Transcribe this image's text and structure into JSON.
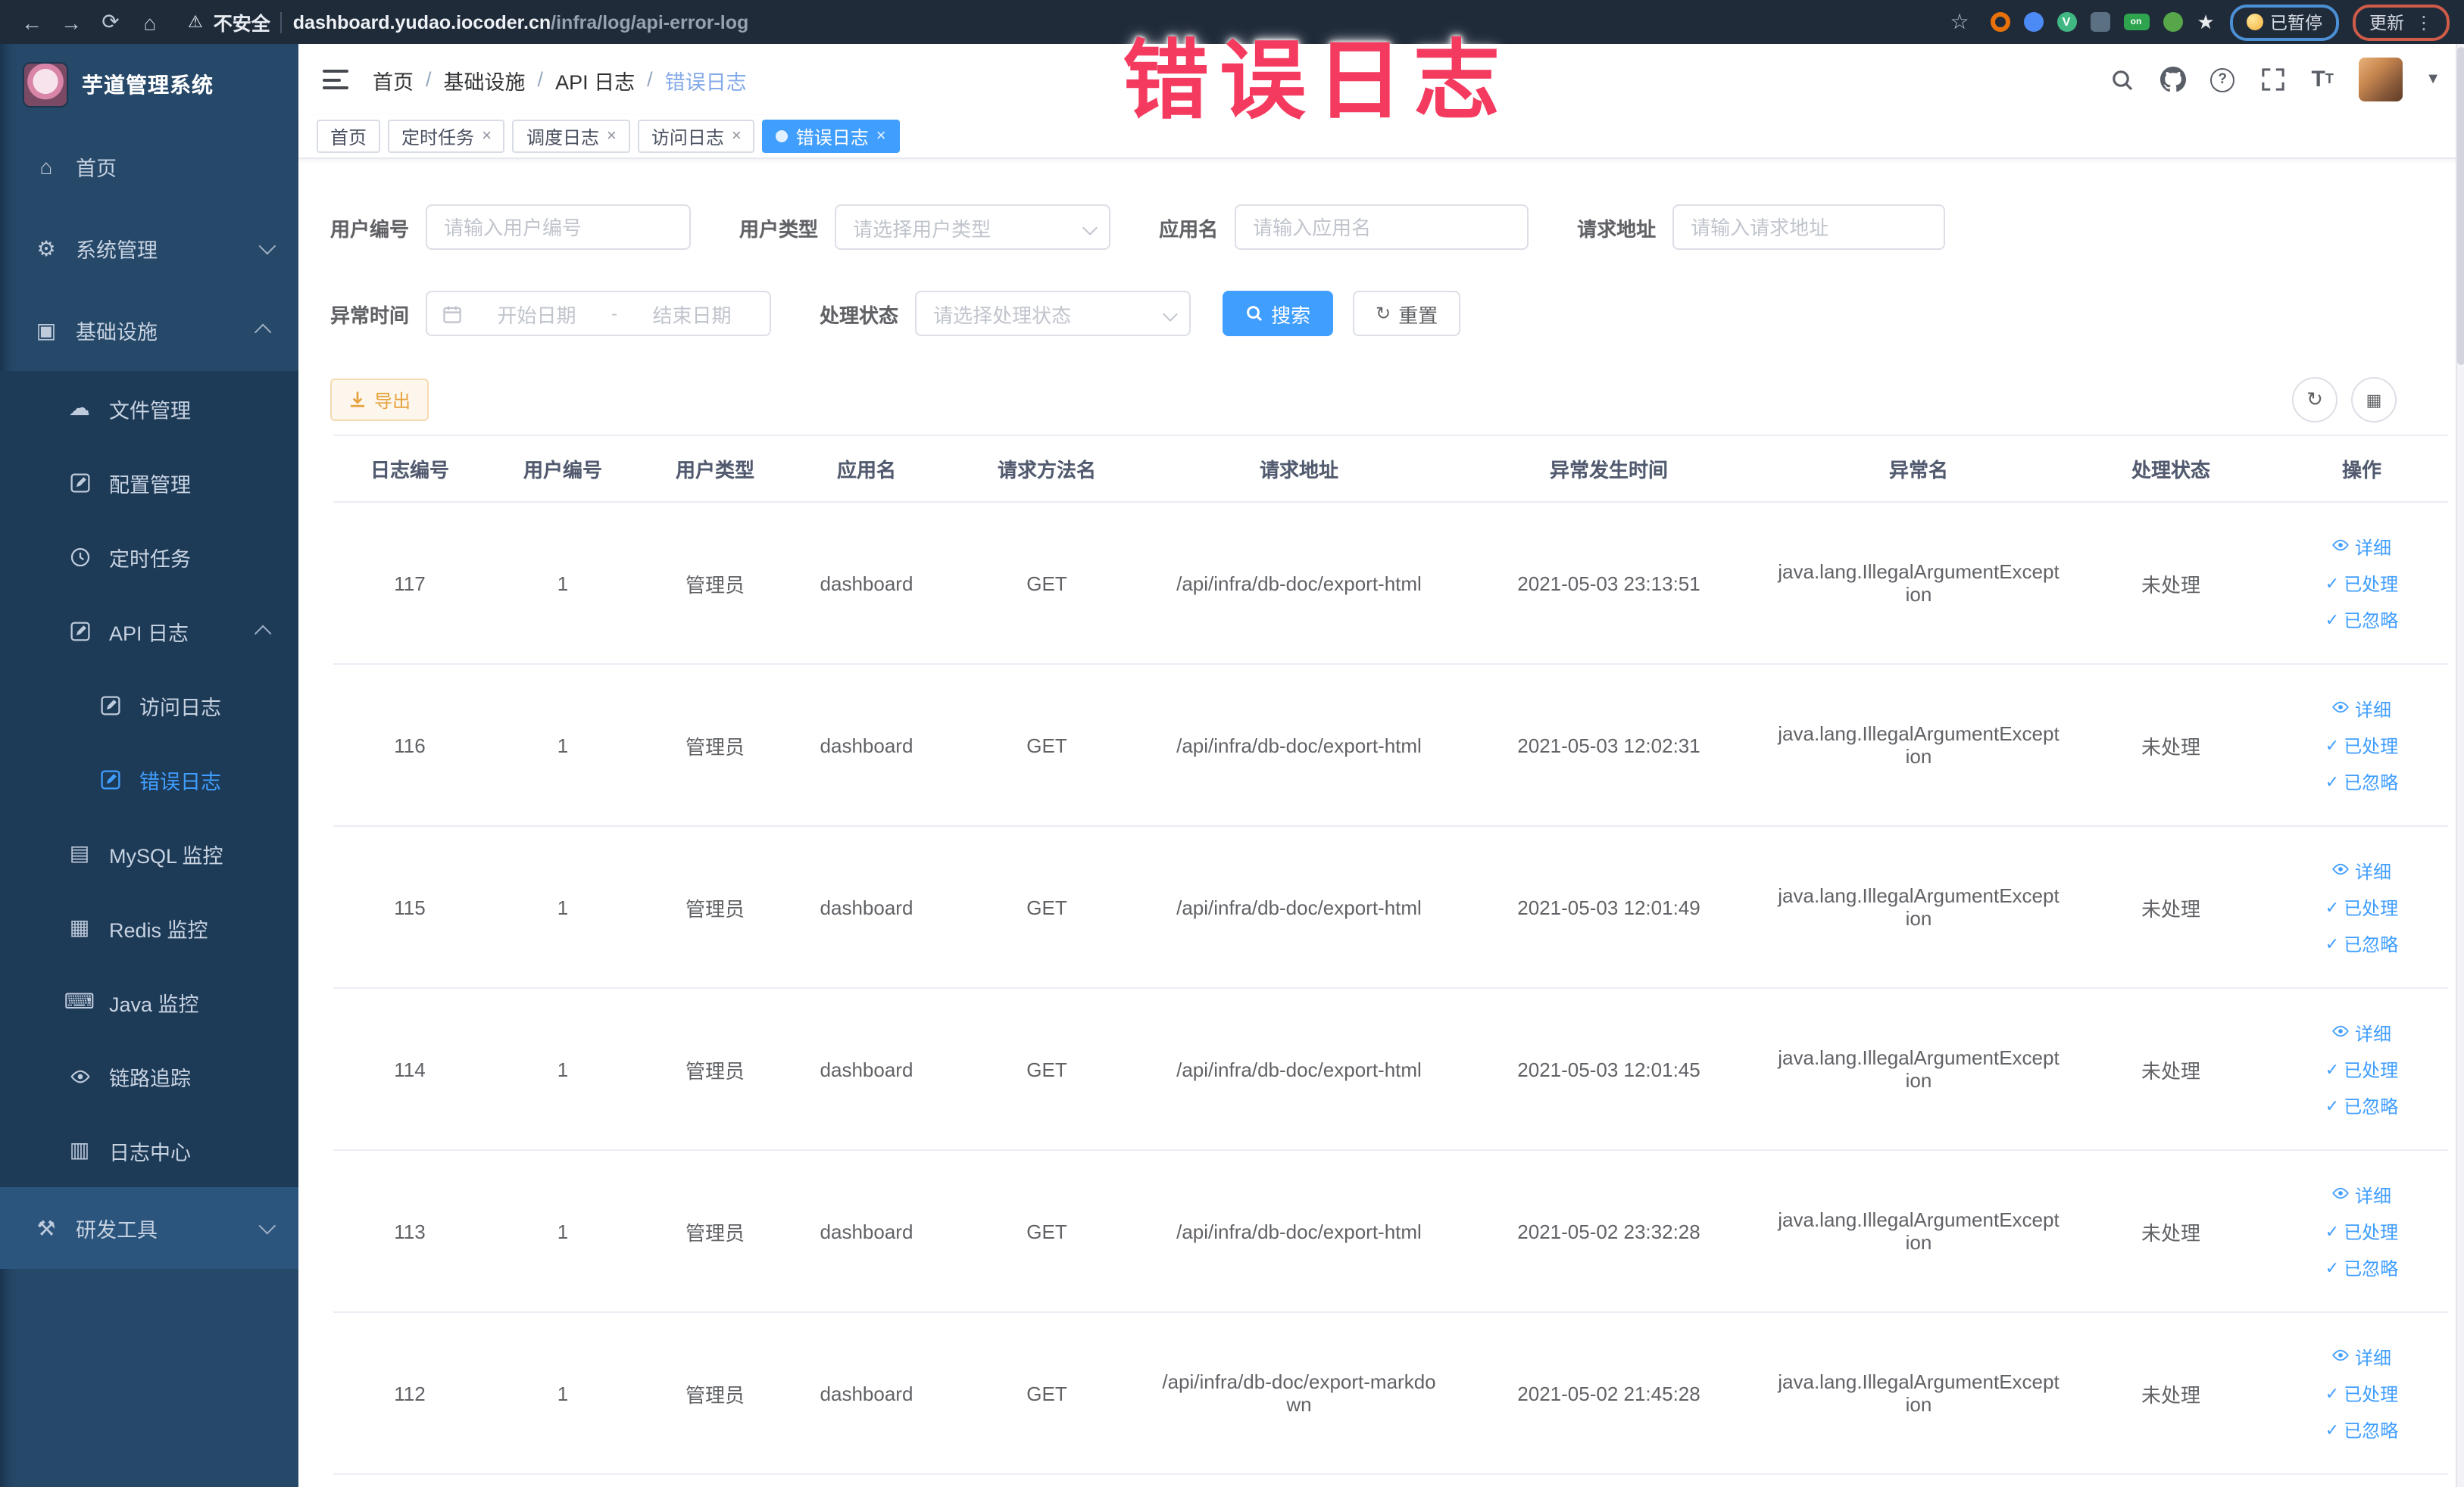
{
  "browser": {
    "security_label": "不安全",
    "url_host": "dashboard.yudao.iocoder.cn",
    "url_path": "/infra/log/api-error-log",
    "paused_badge": "已暂停",
    "update_badge": "更新",
    "extensions": [
      {
        "name": "ext-orange-ring-icon",
        "color": "#e8710a",
        "shape": "ring"
      },
      {
        "name": "ext-blue-drop-icon",
        "color": "#4c8bf5",
        "shape": "circle"
      },
      {
        "name": "ext-vue-devtools-icon",
        "color": "#41b883",
        "shape": "circle",
        "label": "V"
      },
      {
        "name": "ext-grid-icon",
        "color": "#5b7083",
        "shape": "square"
      },
      {
        "name": "ext-switch-on-icon",
        "color": "#2ea44f",
        "shape": "pill",
        "label": "on"
      },
      {
        "name": "ext-leaf-icon",
        "color": "#57a64a",
        "shape": "circle"
      },
      {
        "name": "ext-puzzle-icon",
        "color": "#e8eaed",
        "shape": "star"
      }
    ]
  },
  "annotation": {
    "text": "错误日志",
    "color": "#f43b5f"
  },
  "sidebar": {
    "title": "芋道管理系统",
    "items": [
      {
        "label": "首页",
        "icon": "home-icon",
        "level": 1
      },
      {
        "label": "系统管理",
        "icon": "gear-icon",
        "level": 1,
        "chevron": "down"
      },
      {
        "label": "基础设施",
        "icon": "monitor-icon",
        "level": 1,
        "chevron": "up"
      },
      {
        "label": "文件管理",
        "icon": "cloud-icon",
        "level": 2,
        "sub": true
      },
      {
        "label": "配置管理",
        "icon": "edit-icon",
        "level": 2,
        "sub": true
      },
      {
        "label": "定时任务",
        "icon": "clock-icon",
        "level": 2,
        "sub": true
      },
      {
        "label": "API 日志",
        "icon": "edit-icon",
        "level": 2,
        "sub": true,
        "chevron": "up"
      },
      {
        "label": "访问日志",
        "icon": "edit-icon",
        "level": 3,
        "sub": true
      },
      {
        "label": "错误日志",
        "icon": "edit-icon",
        "level": 3,
        "sub": true,
        "active": true
      },
      {
        "label": "MySQL 监控",
        "icon": "chart-icon",
        "level": 2,
        "sub": true
      },
      {
        "label": "Redis 监控",
        "icon": "layers-icon",
        "level": 2,
        "sub": true
      },
      {
        "label": "Java 监控",
        "icon": "keyboard-icon",
        "level": 2,
        "sub": true
      },
      {
        "label": "链路追踪",
        "icon": "eye-icon",
        "level": 2,
        "sub": true
      },
      {
        "label": "日志中心",
        "icon": "doc-icon",
        "level": 2,
        "sub": true
      },
      {
        "label": "研发工具",
        "icon": "tools-icon",
        "level": 1,
        "chevron": "down",
        "hovered": true
      }
    ]
  },
  "header": {
    "breadcrumb": [
      "首页",
      "基础设施",
      "API 日志",
      "错误日志"
    ],
    "separator": "/"
  },
  "tabs": [
    {
      "label": "首页",
      "closable": false,
      "active": false
    },
    {
      "label": "定时任务",
      "closable": true,
      "active": false
    },
    {
      "label": "调度日志",
      "closable": true,
      "active": false
    },
    {
      "label": "访问日志",
      "closable": true,
      "active": false
    },
    {
      "label": "错误日志",
      "closable": true,
      "active": true
    }
  ],
  "filters": {
    "user_id": {
      "label": "用户编号",
      "placeholder": "请输入用户编号"
    },
    "user_type": {
      "label": "用户类型",
      "placeholder": "请选择用户类型"
    },
    "app_name": {
      "label": "应用名",
      "placeholder": "请输入应用名"
    },
    "request_url": {
      "label": "请求地址",
      "placeholder": "请输入请求地址"
    },
    "exception_time": {
      "label": "异常时间",
      "start_placeholder": "开始日期",
      "separator": "-",
      "end_placeholder": "结束日期"
    },
    "process_status": {
      "label": "处理状态",
      "placeholder": "请选择处理状态"
    },
    "search_label": "搜索",
    "reset_label": "重置"
  },
  "toolbar": {
    "export_label": "导出"
  },
  "table": {
    "headers": [
      "日志编号",
      "用户编号",
      "用户类型",
      "应用名",
      "请求方法名",
      "请求地址",
      "异常发生时间",
      "异常名",
      "处理状态",
      "操作"
    ],
    "action_labels": [
      "详细",
      "已处理",
      "已忽略"
    ],
    "rows": [
      {
        "id": "117",
        "user_id": "1",
        "user_type": "管理员",
        "app": "dashboard",
        "method": "GET",
        "url": "/api/infra/db-doc/export-html",
        "time": "2021-05-03 23:13:51",
        "exception": "java.lang.IllegalArgumentException",
        "status": "未处理"
      },
      {
        "id": "116",
        "user_id": "1",
        "user_type": "管理员",
        "app": "dashboard",
        "method": "GET",
        "url": "/api/infra/db-doc/export-html",
        "time": "2021-05-03 12:02:31",
        "exception": "java.lang.IllegalArgumentException",
        "status": "未处理"
      },
      {
        "id": "115",
        "user_id": "1",
        "user_type": "管理员",
        "app": "dashboard",
        "method": "GET",
        "url": "/api/infra/db-doc/export-html",
        "time": "2021-05-03 12:01:49",
        "exception": "java.lang.IllegalArgumentException",
        "status": "未处理"
      },
      {
        "id": "114",
        "user_id": "1",
        "user_type": "管理员",
        "app": "dashboard",
        "method": "GET",
        "url": "/api/infra/db-doc/export-html",
        "time": "2021-05-03 12:01:45",
        "exception": "java.lang.IllegalArgumentException",
        "status": "未处理"
      },
      {
        "id": "113",
        "user_id": "1",
        "user_type": "管理员",
        "app": "dashboard",
        "method": "GET",
        "url": "/api/infra/db-doc/export-html",
        "time": "2021-05-02 23:32:28",
        "exception": "java.lang.IllegalArgumentException",
        "status": "未处理"
      },
      {
        "id": "112",
        "user_id": "1",
        "user_type": "管理员",
        "app": "dashboard",
        "method": "GET",
        "url": "/api/infra/db-doc/export-markdown",
        "time": "2021-05-02 21:45:28",
        "exception": "java.lang.IllegalArgumentException",
        "status": "未处理"
      }
    ]
  },
  "colors": {
    "accent": "#409eff",
    "warning": "#e6a23c",
    "sidebar": "#264869",
    "sidebar_sub": "#1d3a57",
    "chrome": "#202b3a",
    "annotation": "#f43b5f"
  }
}
